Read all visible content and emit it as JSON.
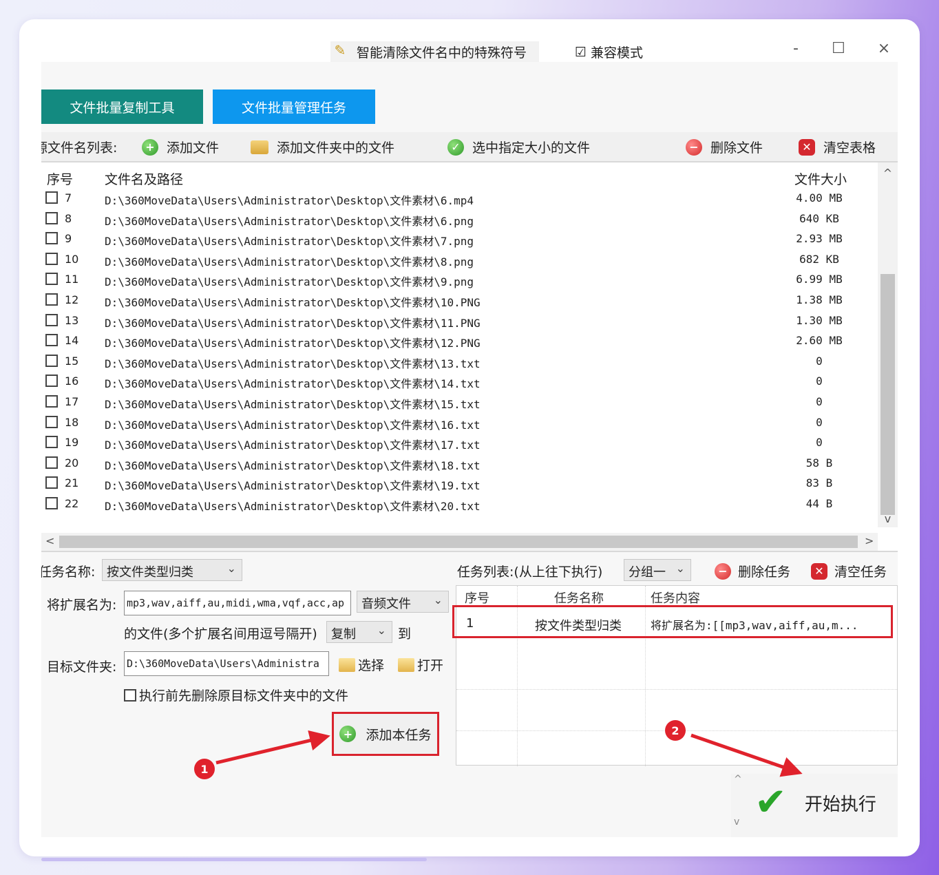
{
  "titlebar": {
    "title": "智能清除文件名中的特殊符号",
    "compat_check": "☑",
    "compat_label": "兼容模式",
    "min": "-",
    "max": "☐",
    "close": "×"
  },
  "tabs": [
    "文件批量复制工具",
    "文件批量管理任务"
  ],
  "toolbar": {
    "list_label": "源文件名列表:",
    "add_file": "添加文件",
    "add_folder_files": "添加文件夹中的文件",
    "select_size": "选中指定大小的文件",
    "delete_file": "删除文件",
    "clear_table": "清空表格"
  },
  "file_list": {
    "headers": {
      "index": "序号",
      "path": "文件名及路径",
      "size": "文件大小"
    },
    "rows": [
      {
        "index": "7",
        "path": "D:\\360MoveData\\Users\\Administrator\\Desktop\\文件素材\\6.mp4",
        "size": "4.00 MB"
      },
      {
        "index": "8",
        "path": "D:\\360MoveData\\Users\\Administrator\\Desktop\\文件素材\\6.png",
        "size": "640 KB"
      },
      {
        "index": "9",
        "path": "D:\\360MoveData\\Users\\Administrator\\Desktop\\文件素材\\7.png",
        "size": "2.93 MB"
      },
      {
        "index": "10",
        "path": "D:\\360MoveData\\Users\\Administrator\\Desktop\\文件素材\\8.png",
        "size": "682 KB"
      },
      {
        "index": "11",
        "path": "D:\\360MoveData\\Users\\Administrator\\Desktop\\文件素材\\9.png",
        "size": "6.99 MB"
      },
      {
        "index": "12",
        "path": "D:\\360MoveData\\Users\\Administrator\\Desktop\\文件素材\\10.PNG",
        "size": "1.38 MB"
      },
      {
        "index": "13",
        "path": "D:\\360MoveData\\Users\\Administrator\\Desktop\\文件素材\\11.PNG",
        "size": "1.30 MB"
      },
      {
        "index": "14",
        "path": "D:\\360MoveData\\Users\\Administrator\\Desktop\\文件素材\\12.PNG",
        "size": "2.60 MB"
      },
      {
        "index": "15",
        "path": "D:\\360MoveData\\Users\\Administrator\\Desktop\\文件素材\\13.txt",
        "size": "0"
      },
      {
        "index": "16",
        "path": "D:\\360MoveData\\Users\\Administrator\\Desktop\\文件素材\\14.txt",
        "size": "0"
      },
      {
        "index": "17",
        "path": "D:\\360MoveData\\Users\\Administrator\\Desktop\\文件素材\\15.txt",
        "size": "0"
      },
      {
        "index": "18",
        "path": "D:\\360MoveData\\Users\\Administrator\\Desktop\\文件素材\\16.txt",
        "size": "0"
      },
      {
        "index": "19",
        "path": "D:\\360MoveData\\Users\\Administrator\\Desktop\\文件素材\\17.txt",
        "size": "0"
      },
      {
        "index": "20",
        "path": "D:\\360MoveData\\Users\\Administrator\\Desktop\\文件素材\\18.txt",
        "size": "58 B"
      },
      {
        "index": "21",
        "path": "D:\\360MoveData\\Users\\Administrator\\Desktop\\文件素材\\19.txt",
        "size": "83 B"
      },
      {
        "index": "22",
        "path": "D:\\360MoveData\\Users\\Administrator\\Desktop\\文件素材\\20.txt",
        "size": "44 B"
      }
    ],
    "scroll_up": "^",
    "scroll_down": "v",
    "scroll_left": "<",
    "scroll_right": ">"
  },
  "task_form": {
    "name_label": "任务名称:",
    "name_value": "按文件类型归类",
    "ext_label": "将扩展名为:",
    "ext_value": "mp3,wav,aiff,au,midi,wma,vqf,acc,ap",
    "ext_type": "音频文件",
    "ext_note": "的文件(多个扩展名间用逗号隔开)",
    "action": "复制",
    "to": "到",
    "target_label": "目标文件夹:",
    "target_value": "D:\\360MoveData\\Users\\Administra",
    "choose": "选择",
    "open": "打开",
    "delete_before": "执行前先删除原目标文件夹中的文件",
    "add_task": "添加本任务",
    "caret": "⌄"
  },
  "task_list": {
    "label": "任务列表:(从上往下执行)",
    "group": "分组一",
    "delete_task": "删除任务",
    "clear_task": "清空任务",
    "headers": {
      "index": "序号",
      "name": "任务名称",
      "content": "任务内容"
    },
    "rows": [
      {
        "index": "1",
        "name": "按文件类型归类",
        "content": "将扩展名为:[[mp3,wav,aiff,au,m..."
      }
    ]
  },
  "start": {
    "label": "开始执行",
    "check": "✔",
    "up": "^",
    "down": "v"
  },
  "annotations": {
    "badge1": "1",
    "badge2": "2"
  },
  "colors": {
    "tab1": "#138a80",
    "tab2": "#0d97ee",
    "highlight": "#d9232d"
  }
}
